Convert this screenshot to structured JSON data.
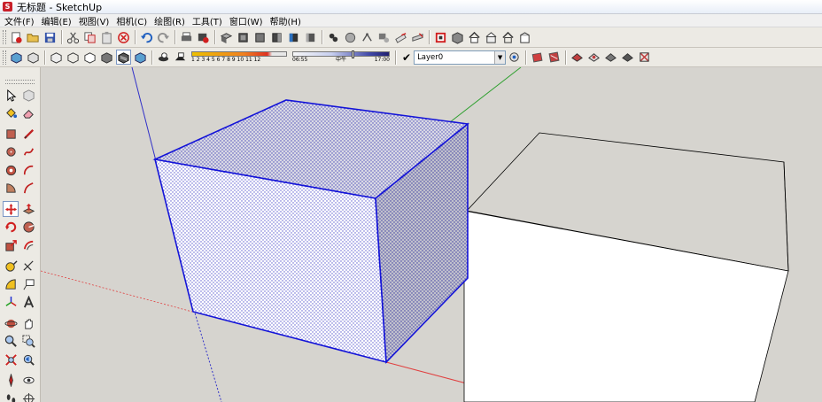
{
  "window": {
    "title": "无标题 - SketchUp",
    "logo_glyph": "S"
  },
  "menu": [
    {
      "label": "文件(F)"
    },
    {
      "label": "编辑(E)"
    },
    {
      "label": "视图(V)"
    },
    {
      "label": "相机(C)"
    },
    {
      "label": "绘图(R)"
    },
    {
      "label": "工具(T)"
    },
    {
      "label": "窗口(W)"
    },
    {
      "label": "帮助(H)"
    }
  ],
  "shadow": {
    "months": "1 2 3 4 5 6 7 8 9 10 11 12",
    "time_start": "06:55",
    "time_mid": "中午",
    "time_end": "17:00"
  },
  "layer": {
    "check": "✔",
    "current": "Layer0",
    "dropdown_glyph": "▼"
  },
  "colors": {
    "selection_edge": "#1414d8",
    "axis_red": "#e04040",
    "axis_green": "#30a030",
    "axis_blue": "#3030c8",
    "background": "#d6d4cf"
  }
}
